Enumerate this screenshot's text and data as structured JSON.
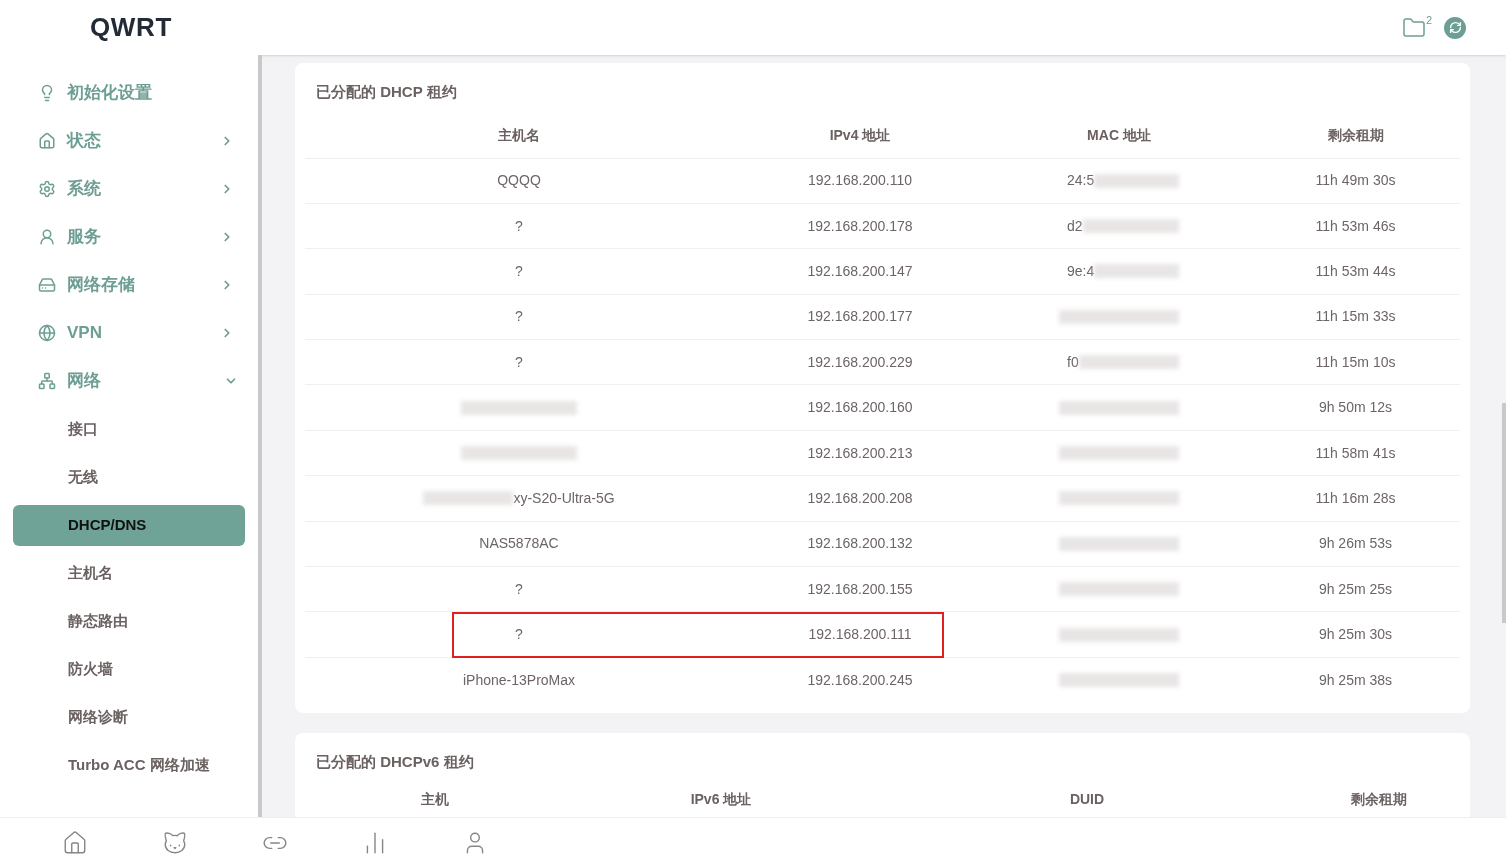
{
  "logo": "QWRT",
  "header": {
    "folder_count": "2"
  },
  "sidebar": {
    "items": [
      {
        "label": "初始化设置"
      },
      {
        "label": "状态",
        "expanded": false
      },
      {
        "label": "系统",
        "expanded": false
      },
      {
        "label": "服务",
        "expanded": false
      },
      {
        "label": "网络存储",
        "expanded": false
      },
      {
        "label": "VPN",
        "expanded": false
      },
      {
        "label": "网络",
        "expanded": true,
        "children": [
          {
            "label": "接口",
            "selected": false
          },
          {
            "label": "无线",
            "selected": false
          },
          {
            "label": "DHCP/DNS",
            "selected": true
          },
          {
            "label": "主机名",
            "selected": false
          },
          {
            "label": "静态路由",
            "selected": false
          },
          {
            "label": "防火墙",
            "selected": false
          },
          {
            "label": "网络诊断",
            "selected": false
          },
          {
            "label": "Turbo ACC 网络加速",
            "selected": false
          }
        ]
      }
    ]
  },
  "dhcp": {
    "title": "已分配的 DHCP 租约",
    "columns": [
      "主机名",
      "IPv4 地址",
      "MAC 地址",
      "剩余租期"
    ],
    "rows": [
      {
        "host": {
          "text": "QQQQ",
          "redacted": false
        },
        "ip": "192.168.200.110",
        "mac": {
          "text": "24:5",
          "redacted": true
        },
        "lease": "11h 49m 30s",
        "highlighted": false
      },
      {
        "host": {
          "text": "?",
          "redacted": false
        },
        "ip": "192.168.200.178",
        "mac": {
          "text": "d2",
          "redacted": true
        },
        "lease": "11h 53m 46s",
        "highlighted": false
      },
      {
        "host": {
          "text": "?",
          "redacted": false
        },
        "ip": "192.168.200.147",
        "mac": {
          "text": "9e:4",
          "redacted": true
        },
        "lease": "11h 53m 44s",
        "highlighted": false
      },
      {
        "host": {
          "text": "?",
          "redacted": false
        },
        "ip": "192.168.200.177",
        "mac": {
          "redacted": true
        },
        "lease": "11h 15m 33s",
        "highlighted": false
      },
      {
        "host": {
          "text": "?",
          "redacted": false
        },
        "ip": "192.168.200.229",
        "mac": {
          "text": "f0",
          "redacted": true
        },
        "lease": "11h 15m 10s",
        "highlighted": false
      },
      {
        "host": {
          "redacted": true
        },
        "ip": "192.168.200.160",
        "mac": {
          "redacted": true
        },
        "lease": "9h 50m 12s",
        "highlighted": false
      },
      {
        "host": {
          "redacted": true
        },
        "ip": "192.168.200.213",
        "mac": {
          "redacted": true
        },
        "lease": "11h 58m 41s",
        "highlighted": false
      },
      {
        "host": {
          "text": "xy-S20-Ultra-5G",
          "redacted": true
        },
        "ip": "192.168.200.208",
        "mac": {
          "redacted": true
        },
        "lease": "11h 16m 28s",
        "highlighted": false
      },
      {
        "host": {
          "text": "NAS5878AC",
          "redacted": false
        },
        "ip": "192.168.200.132",
        "mac": {
          "redacted": true
        },
        "lease": "9h 26m 53s",
        "highlighted": false
      },
      {
        "host": {
          "text": "?",
          "redacted": false
        },
        "ip": "192.168.200.155",
        "mac": {
          "redacted": true
        },
        "lease": "9h 25m 25s",
        "highlighted": false
      },
      {
        "host": {
          "text": "?",
          "redacted": false
        },
        "ip": "192.168.200.111",
        "mac": {
          "redacted": true
        },
        "lease": "9h 25m 30s",
        "highlighted": true
      },
      {
        "host": {
          "text": "iPhone-13ProMax",
          "redacted": false
        },
        "ip": "192.168.200.245",
        "mac": {
          "redacted": true
        },
        "lease": "9h 25m 38s",
        "highlighted": false
      }
    ]
  },
  "dhcpv6": {
    "title": "已分配的 DHCPv6 租约",
    "columns": [
      "主机",
      "IPv6 地址",
      "DUID",
      "剩余租期"
    ]
  }
}
